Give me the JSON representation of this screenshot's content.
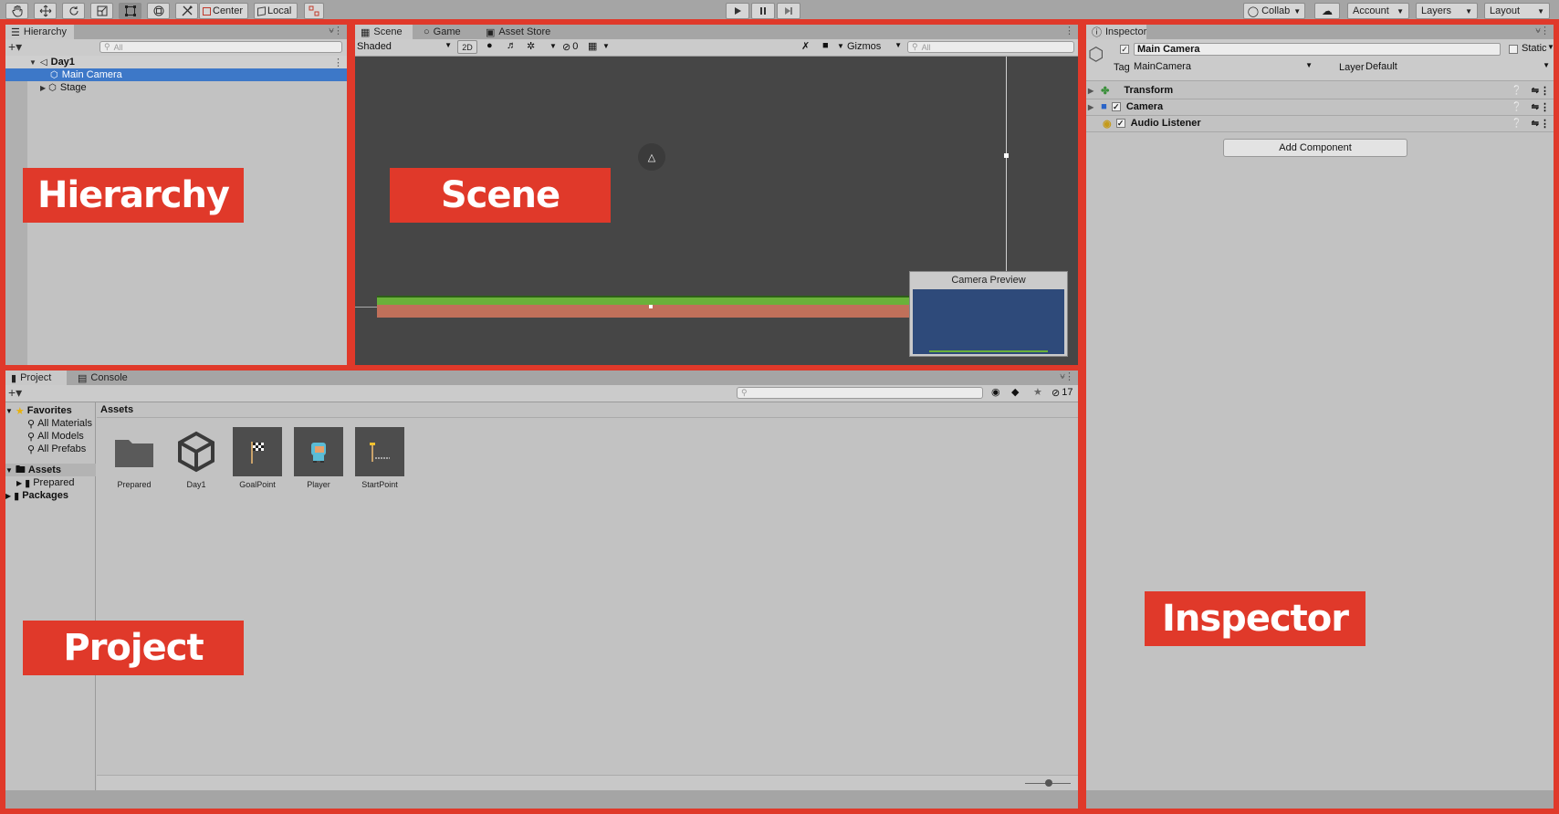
{
  "toolbar": {
    "tools": [
      "hand-tool",
      "move-tool",
      "rotate-tool",
      "scale-tool",
      "rect-tool",
      "transform-tool",
      "custom-tool"
    ],
    "pivot_label": "Center",
    "space_label": "Local",
    "collab_label": "Collab",
    "account_label": "Account",
    "layers_label": "Layers",
    "layout_label": "Layout"
  },
  "hierarchy": {
    "tab_label": "Hierarchy",
    "search_placeholder": "All",
    "scene_name": "Day1",
    "items": [
      {
        "label": "Main Camera",
        "selected": true
      },
      {
        "label": "Stage",
        "selected": false
      }
    ],
    "overlay_label": "Hierarchy"
  },
  "scene": {
    "tabs": [
      "Scene",
      "Game",
      "Asset Store"
    ],
    "shading_mode": "Shaded",
    "mode_2d": "2D",
    "hidden_count": "0",
    "gizmos_label": "Gizmos",
    "search_placeholder": "All",
    "camera_preview_title": "Camera Preview",
    "overlay_label": "Scene",
    "colors": {
      "background": "#464646",
      "grass": "#6ab13a",
      "ground": "#c0705a",
      "preview": "#2e4a7a"
    }
  },
  "project": {
    "tabs": [
      "Project",
      "Console"
    ],
    "hidden_count": "17",
    "favorites_label": "Favorites",
    "favorites": [
      "All Materials",
      "All Models",
      "All Prefabs"
    ],
    "assets_label": "Assets",
    "assets_children": [
      "Prepared"
    ],
    "packages_label": "Packages",
    "breadcrumb": "Assets",
    "assets": [
      {
        "name": "Prepared",
        "icon": "folder-icon"
      },
      {
        "name": "Day1",
        "icon": "unity-scene-icon"
      },
      {
        "name": "GoalPoint",
        "icon": "goal-flag-icon"
      },
      {
        "name": "Player",
        "icon": "player-sprite-icon"
      },
      {
        "name": "StartPoint",
        "icon": "start-flag-icon"
      }
    ],
    "overlay_label": "Project"
  },
  "inspector": {
    "tab_label": "Inspector",
    "object_name": "Main Camera",
    "static_label": "Static",
    "tag_label": "Tag",
    "tag_value": "MainCamera",
    "layer_label": "Layer",
    "layer_value": "Default",
    "components": [
      "Transform",
      "Camera",
      "Audio Listener"
    ],
    "add_component_label": "Add Component",
    "overlay_label": "Inspector"
  },
  "colors": {
    "frame": "#e0392a",
    "selection": "#3d78c8",
    "panel": "#c2c2c2"
  }
}
